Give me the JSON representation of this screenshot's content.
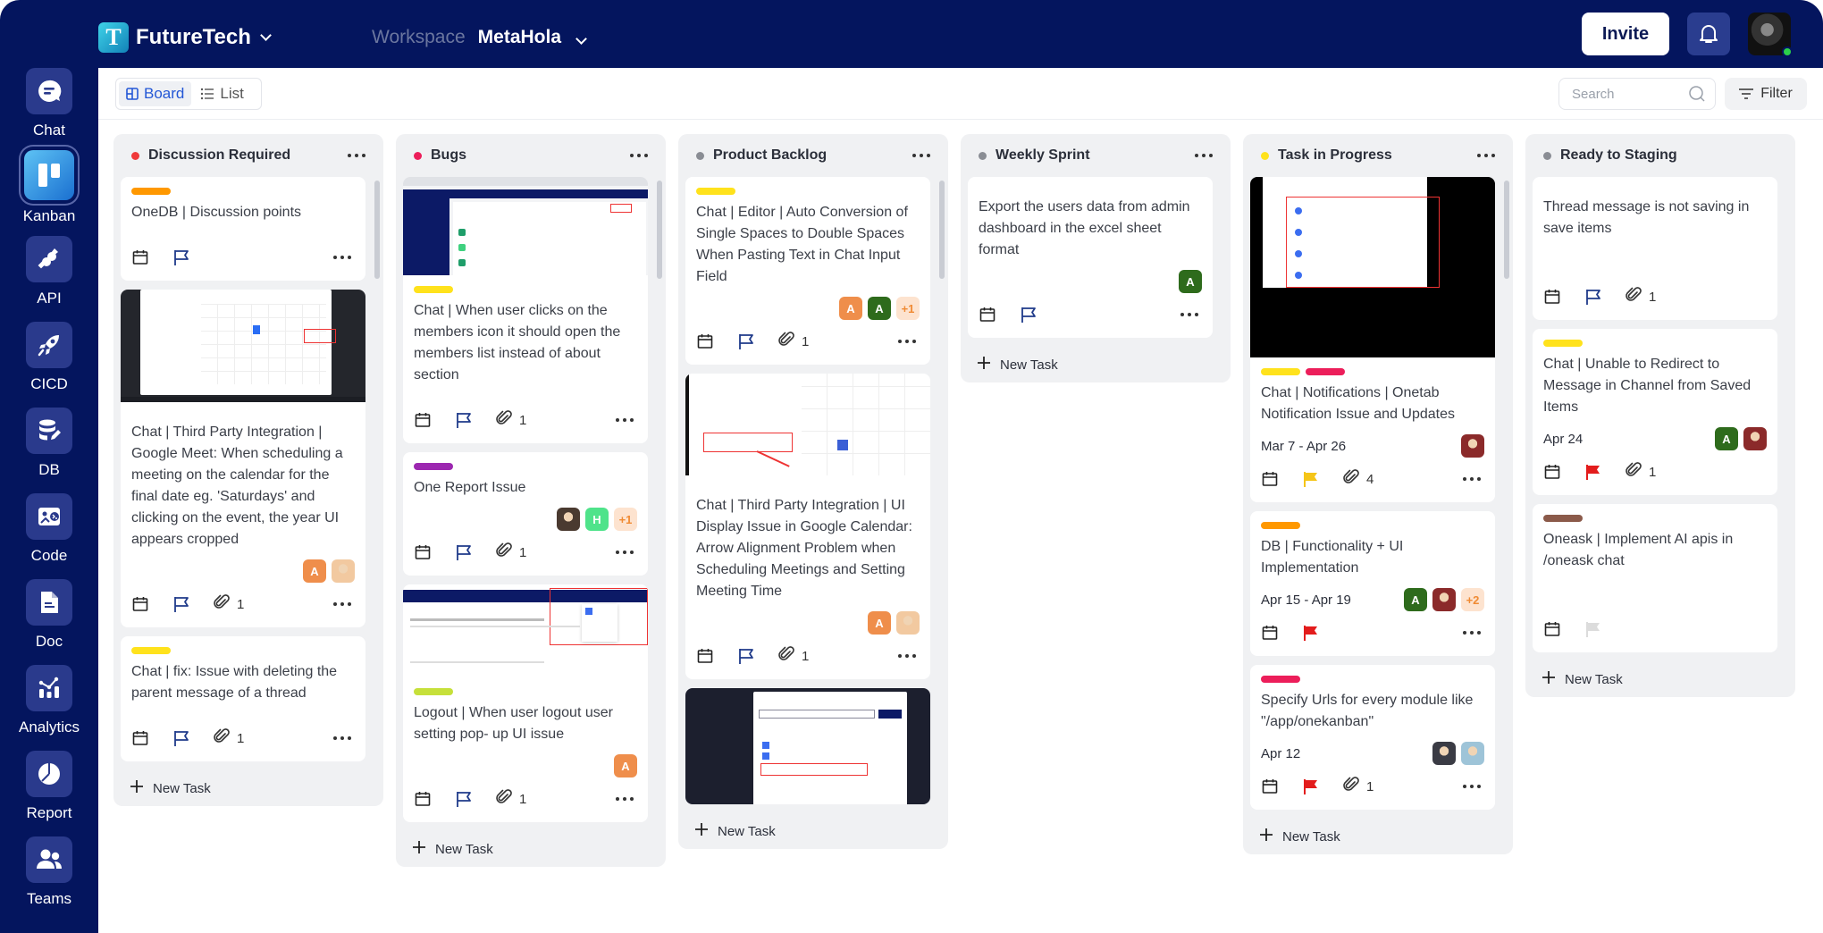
{
  "app": {
    "brand": "FutureTech",
    "brand_logo_letter": "T",
    "workspace_label": "Workspace",
    "workspace_name": "MetaHola",
    "invite_label": "Invite"
  },
  "sidebar": {
    "items": [
      {
        "label": "Chat",
        "icon": "chat-icon"
      },
      {
        "label": "Kanban",
        "icon": "kanban-icon",
        "active": true
      },
      {
        "label": "API",
        "icon": "plug-icon"
      },
      {
        "label": "CICD",
        "icon": "rocket-icon"
      },
      {
        "label": "DB",
        "icon": "database-icon"
      },
      {
        "label": "Code",
        "icon": "code-icon"
      },
      {
        "label": "Doc",
        "icon": "document-icon"
      },
      {
        "label": "Analytics",
        "icon": "analytics-icon"
      },
      {
        "label": "Report",
        "icon": "pie-chart-icon"
      },
      {
        "label": "Teams",
        "icon": "users-icon"
      }
    ]
  },
  "toolbar": {
    "board_label": "Board",
    "list_label": "List",
    "active_view": "Board",
    "search_placeholder": "Search",
    "filter_label": "Filter"
  },
  "colors": {
    "nav_bg": "#04155e",
    "accent": "#2357d6",
    "flag_red": "#e31c1c",
    "flag_yellow": "#f5c518",
    "flag_default": "#1f3a8a",
    "avatar_orange": "#ef8e4b",
    "avatar_green": "#2e6b1c",
    "avatar_lightgreen": "#4fe38a"
  },
  "new_task_label": "New Task",
  "columns": [
    {
      "title": "Discussion Required",
      "dot": "#f03a3a",
      "cards": [
        {
          "tags": [
            "#ff9800"
          ],
          "title": "OneDB | Discussion points",
          "flag": "default",
          "attachments": null,
          "assignees": []
        },
        {
          "thumbnail": "calendar-screenshot",
          "tags": [],
          "title": "Chat | Third Party Integration | Google Meet: When scheduling a meeting on the calendar for the final date eg. 'Saturdays' and clicking on the event, the year UI appears cropped",
          "flag": "default",
          "attachments": "1",
          "assignees": [
            {
              "type": "letter",
              "text": "A",
              "color": "#ef8e4b"
            },
            {
              "type": "photo",
              "color": "#f2c9a0"
            }
          ]
        },
        {
          "tags": [
            "#ffe21c"
          ],
          "title": "Chat | fix: Issue with deleting the parent message of a thread",
          "flag": "default",
          "attachments": "1",
          "assignees": []
        }
      ]
    },
    {
      "title": "Bugs",
      "dot": "#ec1e5a",
      "cards": [
        {
          "thumbnail": "chat-screenshot",
          "tags": [
            "#ffe21c"
          ],
          "title": "Chat | When user clicks on the members icon it should open the members list instead of about section",
          "flag": "default",
          "attachments": "1",
          "assignees": []
        },
        {
          "tags": [
            "#9c27b0"
          ],
          "title": "One Report Issue",
          "flag": "default",
          "attachments": "1",
          "assignees": [
            {
              "type": "photo",
              "color": "#4a3a30"
            },
            {
              "type": "letter",
              "text": "H",
              "color": "#4fe38a"
            },
            {
              "type": "plus",
              "text": "+1"
            }
          ]
        },
        {
          "thumbnail": "logout-screenshot",
          "tags": [
            "#c6e03a"
          ],
          "title": "Logout | When user logout user setting pop- up UI issue",
          "flag": "default",
          "attachments": "1",
          "assignees": [
            {
              "type": "letter",
              "text": "A",
              "color": "#ef8e4b"
            }
          ]
        }
      ]
    },
    {
      "title": "Product Backlog",
      "dot": "#8a8d94",
      "cards": [
        {
          "tags": [
            "#ffe21c"
          ],
          "title": "Chat | Editor | Auto Conversion of Single Spaces to Double Spaces When Pasting Text in Chat Input Field",
          "flag": "default",
          "attachments": "1",
          "assignees": [
            {
              "type": "letter",
              "text": "A",
              "color": "#ef8e4b"
            },
            {
              "type": "letter",
              "text": "A",
              "color": "#2e6b1c"
            },
            {
              "type": "plus",
              "text": "+1"
            }
          ]
        },
        {
          "thumbnail": "schedule-screenshot",
          "tags": [],
          "title": "Chat | Third Party Integration | UI Display Issue in Google Calendar: Arrow Alignment Problem when Scheduling Meetings and Setting Meeting Time",
          "flag": "default",
          "attachments": "1",
          "assignees": [
            {
              "type": "letter",
              "text": "A",
              "color": "#ef8e4b"
            },
            {
              "type": "photo",
              "color": "#f2c9a0"
            }
          ]
        },
        {
          "thumbnail": "invite-screenshot",
          "tags": [],
          "title": "",
          "partial": true
        }
      ]
    },
    {
      "title": "Weekly Sprint",
      "dot": "#8a8d94",
      "cards": [
        {
          "tags": [],
          "title": "Export the users data from admin dashboard in the excel sheet format",
          "flag": "default",
          "attachments": null,
          "assignees": [
            {
              "type": "letter",
              "text": "A",
              "color": "#2e6b1c"
            }
          ]
        }
      ]
    },
    {
      "title": "Task in Progress",
      "dot": "#ffe21c",
      "cards": [
        {
          "thumbnail": "notifications-screenshot",
          "tags": [
            "#ffe21c",
            "#ec1e5a"
          ],
          "title": "Chat | Notifications | Onetab Notification Issue and Updates",
          "date": "Mar 7 - Apr 26",
          "flag": "yellow",
          "attachments": "4",
          "assignees": [
            {
              "type": "photo",
              "color": "#8b2a2a"
            }
          ]
        },
        {
          "tags": [
            "#ff9800"
          ],
          "title": "DB | Functionality + UI Implementation",
          "date": "Apr 15 - Apr 19",
          "flag": "red",
          "attachments": null,
          "assignees": [
            {
              "type": "letter",
              "text": "A",
              "color": "#2e6b1c"
            },
            {
              "type": "photo",
              "color": "#8b2a2a"
            },
            {
              "type": "plus",
              "text": "+2"
            }
          ]
        },
        {
          "tags": [
            "#ec1e5a"
          ],
          "title": "Specify Urls for every module like \"/app/onekanban\"",
          "date": "Apr 12",
          "flag": "red",
          "attachments": "1",
          "assignees": [
            {
              "type": "photo",
              "color": "#3a3b44"
            },
            {
              "type": "photo",
              "color": "#9ec4d8"
            }
          ]
        }
      ]
    },
    {
      "title": "Ready to Staging",
      "dot": "#8a8d94",
      "cards": [
        {
          "tags": [],
          "title": "Thread message is not saving in save items",
          "flag": "default",
          "attachments": "1",
          "assignees": [],
          "no_more": true
        },
        {
          "tags": [
            "#ffe21c"
          ],
          "title": "Chat | Unable to Redirect to Message in Channel from Saved Items",
          "date": "Apr 24",
          "flag": "red",
          "attachments": "1",
          "assignees": [
            {
              "type": "letter",
              "text": "A",
              "color": "#2e6b1c"
            },
            {
              "type": "photo",
              "color": "#8b2a2a"
            }
          ],
          "no_more": true
        },
        {
          "tags": [
            "#8b5a4a"
          ],
          "title": "Oneask | Implement AI apis in /oneask chat",
          "flag": "none",
          "attachments": null,
          "assignees": [],
          "no_more": true
        }
      ]
    }
  ]
}
